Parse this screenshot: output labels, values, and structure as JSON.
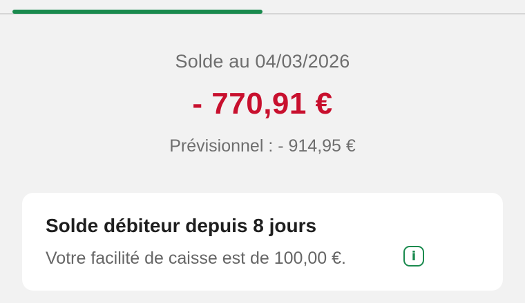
{
  "balance": {
    "date_label": "Solde au 04/03/2026",
    "amount": "- 770,91 €",
    "forecast": "Prévisionnel : - 914,95 €"
  },
  "alert_card": {
    "title": "Solde débiteur depuis 8 jours",
    "text": "Votre facilité de caisse est de 100,00 €.",
    "info_icon_glyph": "i"
  },
  "colors": {
    "accent_green": "#1a8a4e",
    "negative_red": "#c8102e"
  },
  "icons": {
    "info": "info-icon"
  }
}
